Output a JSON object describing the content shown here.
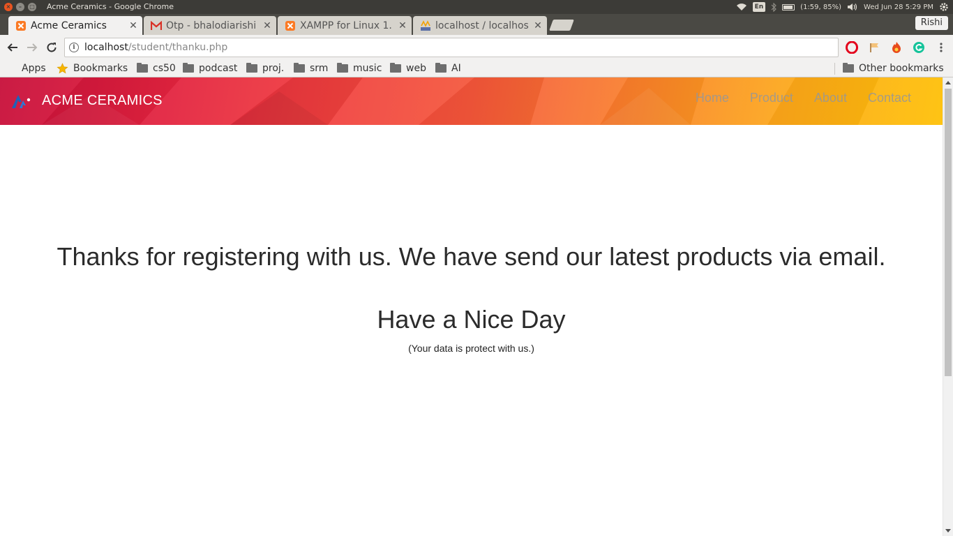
{
  "os": {
    "window_title": "Acme Ceramics - Google Chrome",
    "input_lang": "En",
    "battery": "(1:59, 85%)",
    "clock": "Wed Jun 28  5:29 PM"
  },
  "tabs": [
    {
      "label": "Acme Ceramics",
      "favicon": "xampp-icon",
      "active": true
    },
    {
      "label": "Otp - bhalodiarishi",
      "favicon": "gmail-icon",
      "active": false
    },
    {
      "label": "XAMPP for Linux 1.",
      "favicon": "xampp-icon",
      "active": false
    },
    {
      "label": "localhost / localhos",
      "favicon": "phpmyadmin-icon",
      "active": false
    }
  ],
  "profile_name": "Rishi",
  "address_bar": {
    "host": "localhost",
    "path": "/student/thanku.php"
  },
  "bookmarks": {
    "items": [
      {
        "label": "Apps",
        "icon": "apps-grid-icon"
      },
      {
        "label": "Bookmarks",
        "icon": "star-icon"
      },
      {
        "label": "cs50",
        "icon": "folder-icon"
      },
      {
        "label": "podcast",
        "icon": "folder-icon"
      },
      {
        "label": "proj.",
        "icon": "folder-icon"
      },
      {
        "label": "srm",
        "icon": "folder-icon"
      },
      {
        "label": "music",
        "icon": "folder-icon"
      },
      {
        "label": "web",
        "icon": "folder-icon"
      },
      {
        "label": "AI",
        "icon": "folder-icon"
      }
    ],
    "other": "Other bookmarks"
  },
  "site": {
    "brand": "ACME CERAMICS",
    "nav": [
      "Home",
      "Product",
      "About",
      "Contact"
    ],
    "message": "Thanks for registering with us. We have send our latest products via email.",
    "greeting": "Have a Nice Day",
    "note": "(Your data is protect with us.)"
  },
  "colors": {
    "header_start": "#c80f3a",
    "header_end": "#fec106",
    "text": "#2b2b2b",
    "nav_link": "#969696"
  }
}
